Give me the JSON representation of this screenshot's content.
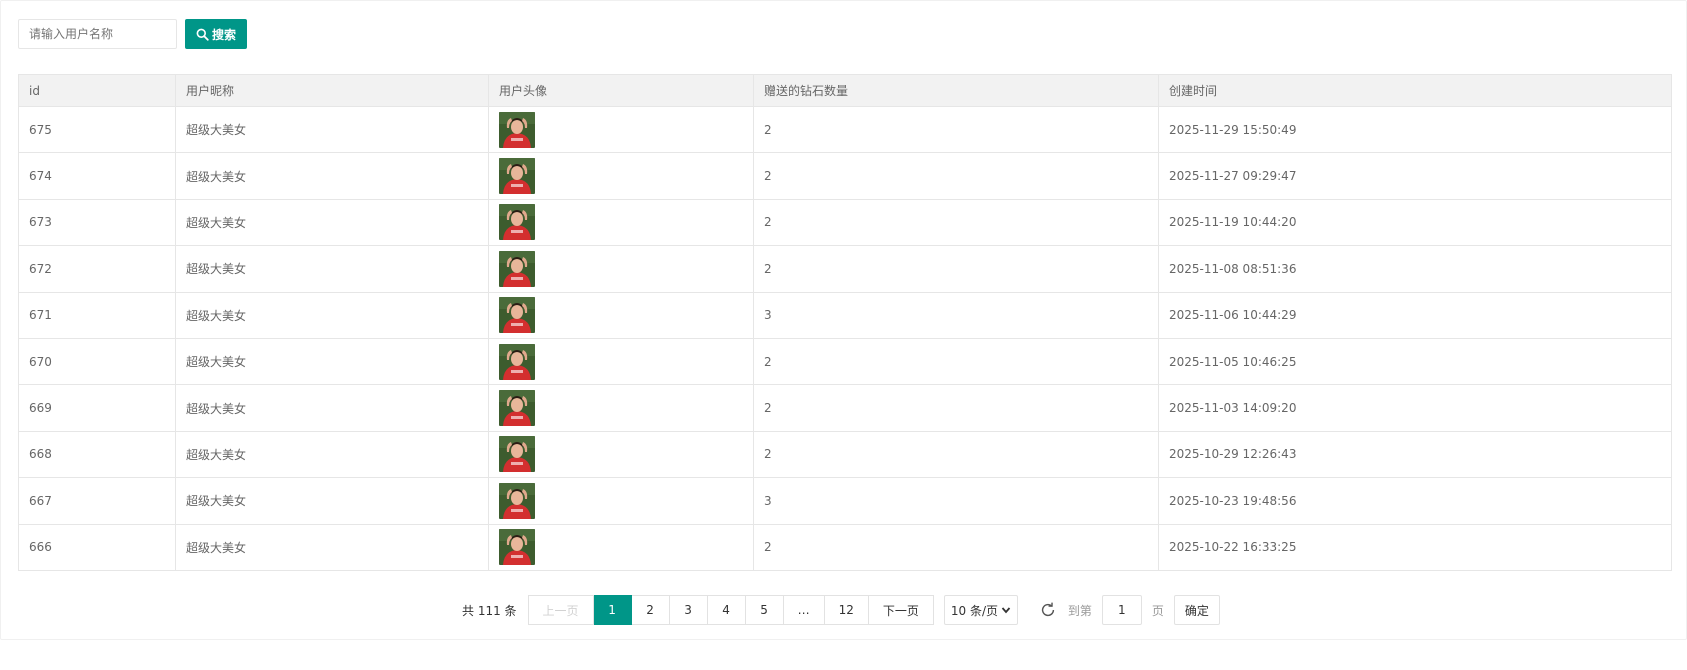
{
  "search": {
    "placeholder": "请输入用户名称",
    "button_label": "搜索"
  },
  "table": {
    "columns": [
      "id",
      "用户昵称",
      "用户头像",
      "赠送的钻石数量",
      "创建时间"
    ],
    "rows": [
      {
        "id": "675",
        "nickname": "超级大美女",
        "diamonds": "2",
        "created": "2025-11-29 15:50:49"
      },
      {
        "id": "674",
        "nickname": "超级大美女",
        "diamonds": "2",
        "created": "2025-11-27 09:29:47"
      },
      {
        "id": "673",
        "nickname": "超级大美女",
        "diamonds": "2",
        "created": "2025-11-19 10:44:20"
      },
      {
        "id": "672",
        "nickname": "超级大美女",
        "diamonds": "2",
        "created": "2025-11-08 08:51:36"
      },
      {
        "id": "671",
        "nickname": "超级大美女",
        "diamonds": "3",
        "created": "2025-11-06 10:44:29"
      },
      {
        "id": "670",
        "nickname": "超级大美女",
        "diamonds": "2",
        "created": "2025-11-05 10:46:25"
      },
      {
        "id": "669",
        "nickname": "超级大美女",
        "diamonds": "2",
        "created": "2025-11-03 14:09:20"
      },
      {
        "id": "668",
        "nickname": "超级大美女",
        "diamonds": "2",
        "created": "2025-10-29 12:26:43"
      },
      {
        "id": "667",
        "nickname": "超级大美女",
        "diamonds": "3",
        "created": "2025-10-23 19:48:56"
      },
      {
        "id": "666",
        "nickname": "超级大美女",
        "diamonds": "2",
        "created": "2025-10-22 16:33:25"
      }
    ]
  },
  "pagination": {
    "total_label": "共 111 条",
    "prev_label": "上一页",
    "pages": [
      "1",
      "2",
      "3",
      "4",
      "5",
      "…",
      "12"
    ],
    "current_page": "1",
    "next_label": "下一页",
    "page_size_label": "10 条/页",
    "goto_label": "到第",
    "goto_value": "1",
    "page_suffix": "页",
    "confirm_label": "确定"
  },
  "icons": {
    "search": "search-icon",
    "refresh": "refresh-icon",
    "dropdown": "chevron-down-icon"
  },
  "colors": {
    "accent": "#009688",
    "header_bg": "#f2f2f2",
    "border": "#e6e6e6"
  }
}
